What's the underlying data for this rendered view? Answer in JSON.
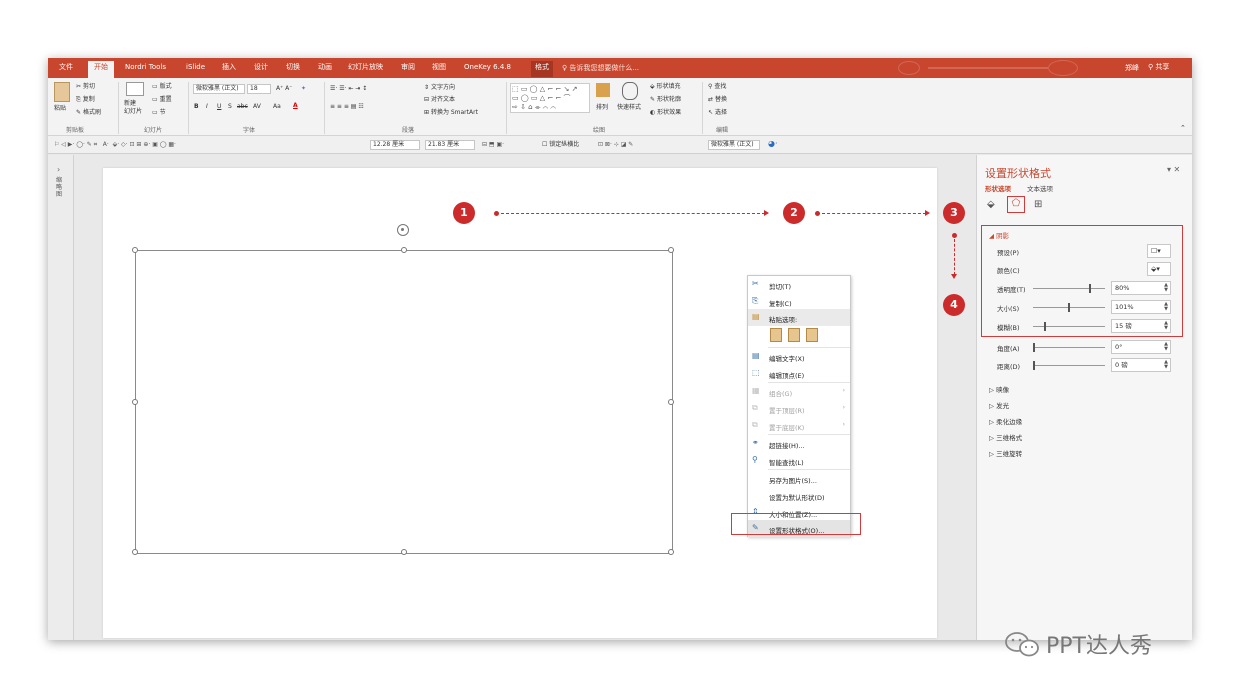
{
  "tabs": [
    "文件",
    "开始",
    "Nordri Tools",
    "iSlide",
    "插入",
    "设计",
    "切换",
    "动画",
    "幻灯片放映",
    "审阅",
    "视图",
    "OneKey 6.4.8",
    "格式"
  ],
  "active_tab": "开始",
  "tell_me": "告诉我您想要做什么...",
  "user": "郑峰",
  "share": "共享",
  "ribbon": {
    "paste": "粘贴",
    "cut": "剪切",
    "copy": "复制",
    "format_painter": "格式刷",
    "new_slide": "新建\n幻灯片",
    "layout": "版式",
    "reset": "重置",
    "section": "节",
    "font_name": "微软雅黑 (正文)",
    "font_size": "18",
    "bold": "B",
    "italic": "I",
    "underline": "U",
    "shadow": "S",
    "strike": "abc",
    "char_spacing": "AV",
    "case": "Aa",
    "text_direction": "文字方向",
    "align_text": "对齐文本",
    "smartart": "转换为 SmartArt",
    "arrange": "排列",
    "quick_styles": "快速样式",
    "shape_fill": "形状填充",
    "shape_outline": "形状轮廓",
    "shape_effects": "形状效果",
    "find": "查找",
    "replace": "替换",
    "select": "选择",
    "groups": [
      "剪贴板",
      "幻灯片",
      "字体",
      "段落",
      "绘图",
      "编辑"
    ]
  },
  "qbar": {
    "width": "12.28 厘米",
    "height": "21.83 厘米",
    "lock_ratio": "锁定纵横比",
    "font": "微软雅黑 (正文)"
  },
  "left_pane_label": "缩略图",
  "context_menu": {
    "items": [
      {
        "label": "剪切(T)",
        "icon": "scissors-icon",
        "glyph": "✂",
        "enabled": true
      },
      {
        "label": "复制(C)",
        "icon": "copy-icon",
        "glyph": "⎘",
        "enabled": true
      },
      {
        "label": "粘贴选项:",
        "icon": "paste-icon",
        "glyph": "📋",
        "enabled": true
      },
      {
        "label": "编辑文字(X)",
        "icon": "edit-text-icon",
        "glyph": "▤",
        "enabled": true
      },
      {
        "label": "编辑顶点(E)",
        "icon": "edit-points-icon",
        "glyph": "⬚",
        "enabled": true
      },
      {
        "label": "组合(G)",
        "icon": "group-icon",
        "glyph": "▦",
        "enabled": false
      },
      {
        "label": "置于顶层(R)",
        "icon": "bring-front-icon",
        "glyph": "⧉",
        "enabled": false
      },
      {
        "label": "置于底层(K)",
        "icon": "send-back-icon",
        "glyph": "⧉",
        "enabled": false
      },
      {
        "label": "超链接(H)...",
        "icon": "hyperlink-icon",
        "glyph": "🔗",
        "enabled": true
      },
      {
        "label": "智能查找(L)",
        "icon": "smart-lookup-icon",
        "glyph": "⚲",
        "enabled": true
      },
      {
        "label": "另存为图片(S)...",
        "icon": "",
        "glyph": "",
        "enabled": true
      },
      {
        "label": "设置为默认形状(D)",
        "icon": "",
        "glyph": "",
        "enabled": true
      },
      {
        "label": "大小和位置(Z)...",
        "icon": "size-position-icon",
        "glyph": "⇕",
        "enabled": true
      },
      {
        "label": "设置形状格式(O)...",
        "icon": "format-shape-icon",
        "glyph": "✎",
        "enabled": true
      }
    ]
  },
  "steps": [
    "1",
    "2",
    "3",
    "4"
  ],
  "format_pane": {
    "title": "设置形状格式",
    "tab_shape": "形状选项",
    "tab_text": "文本选项",
    "section_shadow": "阴影",
    "preset_label": "预设(P)",
    "color_label": "颜色(C)",
    "transparency_label": "透明度(T)",
    "transparency_value": "80%",
    "transparency_level": 0.8,
    "size_label": "大小(S)",
    "size_value": "101%",
    "size_level": 0.5,
    "blur_label": "模糊(B)",
    "blur_value": "15 磅",
    "blur_level": 0.15,
    "angle_label": "角度(A)",
    "angle_value": "0°",
    "angle_level": 0.0,
    "distance_label": "距离(D)",
    "distance_value": "0 磅",
    "distance_level": 0.0,
    "sections": [
      "映像",
      "发光",
      "柔化边缘",
      "三维格式",
      "三维旋转"
    ]
  },
  "watermark": "PPT达人秀"
}
